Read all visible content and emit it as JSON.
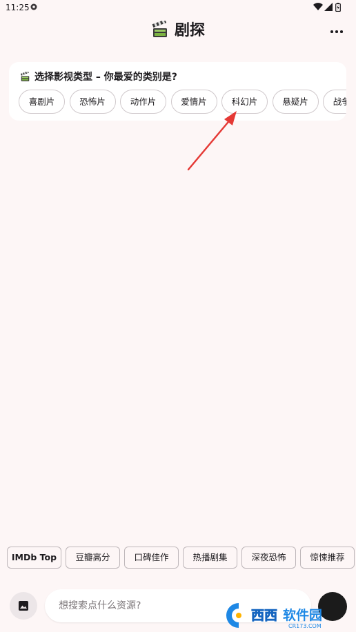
{
  "status_bar": {
    "time": "11:25"
  },
  "header": {
    "title": "剧探",
    "icon": "clapperboard-icon",
    "menu_icon": "more-horizontal-icon"
  },
  "genre_card": {
    "title": "选择影视类型 – 你最爱的类别是?",
    "icon": "clapperboard-icon",
    "genres": [
      "喜剧片",
      "恐怖片",
      "动作片",
      "爱情片",
      "科幻片",
      "悬疑片",
      "战争片"
    ]
  },
  "quick_actions": [
    "IMDb Top",
    "豆瓣高分",
    "口碑佳作",
    "热播剧集",
    "深夜恐怖",
    "惊悚推荐"
  ],
  "search": {
    "placeholder": "想搜索点什么资源?"
  },
  "colors": {
    "background": "#fdf6f6",
    "arrow": "#e53935",
    "chip_border": "#cfc8cb"
  }
}
